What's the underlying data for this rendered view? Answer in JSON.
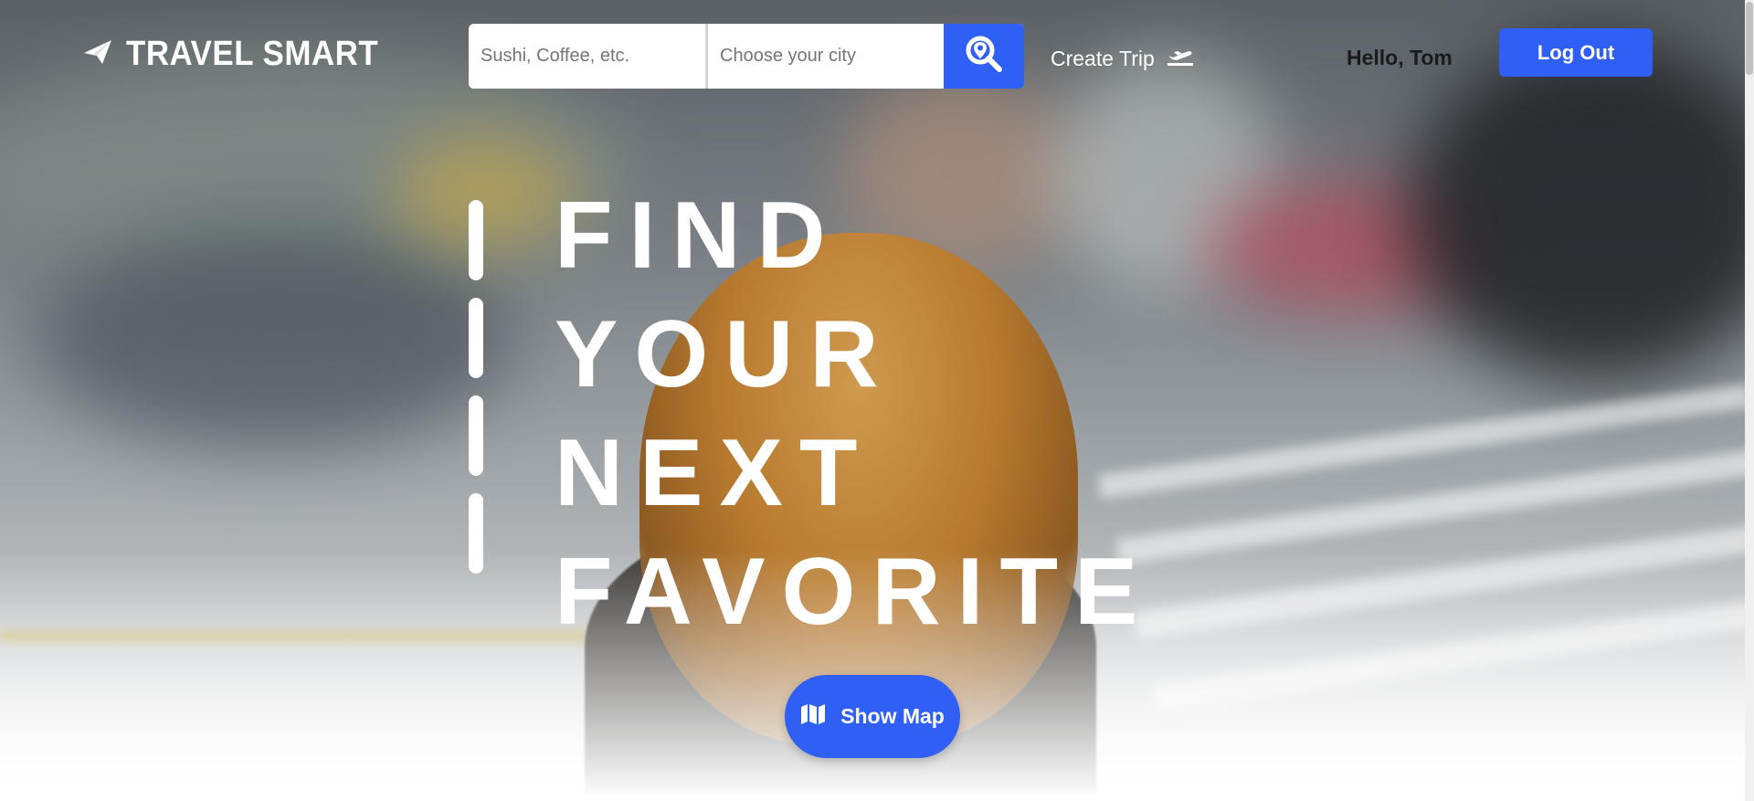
{
  "brand": {
    "name": "TRAVEL SMART",
    "icon": "paper-plane-icon"
  },
  "search": {
    "what_placeholder": "Sushi, Coffee, etc.",
    "what_value": "",
    "city_placeholder": "Choose your city",
    "city_value": "",
    "button_icon": "search-location-icon"
  },
  "nav": {
    "create_trip_label": "Create Trip",
    "create_trip_icon": "plane-departure-icon",
    "greeting": "Hello, Tom",
    "logout_label": "Log Out"
  },
  "hero": {
    "headline": [
      "FIND",
      "YOUR",
      "NEXT",
      "FAVORITE"
    ],
    "show_map_label": "Show Map",
    "show_map_icon": "map-icon"
  },
  "colors": {
    "accent": "#2f5ff4",
    "text_light": "#ffffff",
    "text_dark": "#1b1b1b"
  }
}
